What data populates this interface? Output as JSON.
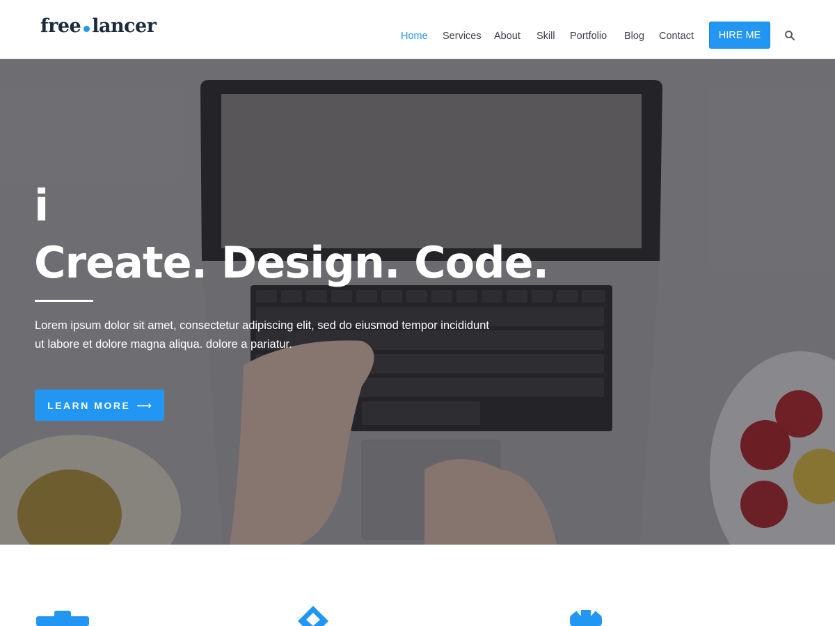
{
  "logo": {
    "part1": "free",
    "part2": "lancer"
  },
  "nav": {
    "items": [
      {
        "label": "Home",
        "active": true
      },
      {
        "label": "Services"
      },
      {
        "label": "About"
      },
      {
        "label": "Skill"
      },
      {
        "label": "Portfolio"
      },
      {
        "label": "Blog"
      },
      {
        "label": "Contact"
      }
    ],
    "hire_label": "HIRE ME",
    "search_icon": "search-icon"
  },
  "hero": {
    "line1": "i",
    "title": "Create. Design. Code.",
    "text": "Lorem ipsum dolor sit amet, consectetur adipiscing elit, sed do eiusmod tempor incididunt ut labore et dolore magna aliqua. dolore a pariatur.",
    "button_label": "LEARN MORE",
    "button_icon": "arrow-right-icon"
  },
  "features": {
    "icons": [
      "briefcase-icon",
      "diamond-icon",
      "gear-icon"
    ]
  },
  "colors": {
    "accent": "#2196f3",
    "logo_text": "#1b2a3d",
    "nav_text": "#3a3f47"
  }
}
